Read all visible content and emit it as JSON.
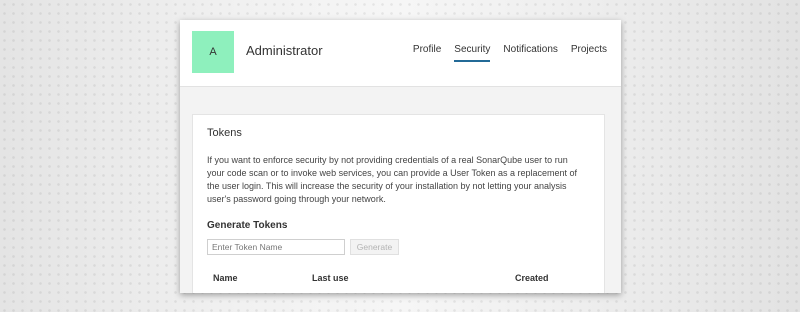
{
  "user": {
    "avatar_letter": "A",
    "name": "Administrator"
  },
  "nav": {
    "tabs": [
      {
        "label": "Profile",
        "active": false
      },
      {
        "label": "Security",
        "active": true
      },
      {
        "label": "Notifications",
        "active": false
      },
      {
        "label": "Projects",
        "active": false
      }
    ]
  },
  "tokens": {
    "title": "Tokens",
    "description": "If you want to enforce security by not providing credentials of a real SonarQube user to run your code scan or to invoke web services, you can provide a User Token as a replacement of the user login. This will increase the security of your installation by not letting your analysis user's password going through your network.",
    "generate_title": "Generate Tokens",
    "input_placeholder": "Enter Token Name",
    "input_value": "",
    "generate_button": "Generate",
    "table_headers": {
      "name": "Name",
      "last_use": "Last use",
      "created": "Created"
    }
  },
  "colors": {
    "avatar_bg": "#8ef0bd",
    "active_tab_underline": "#236a97"
  }
}
